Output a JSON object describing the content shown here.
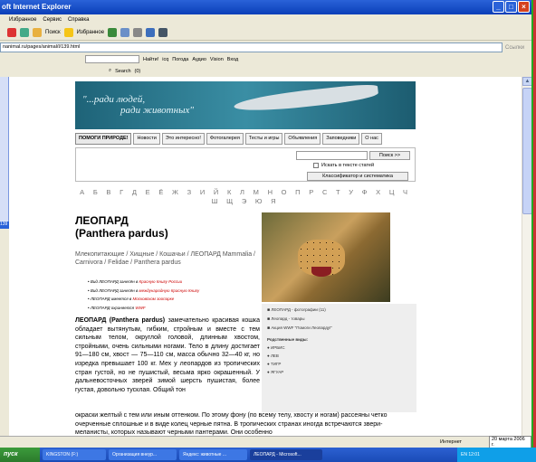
{
  "window": {
    "title": "oft Internet Explorer"
  },
  "menu": [
    "Избранное",
    "Сервис",
    "Справка"
  ],
  "toolbar": {
    "search": "Поиск",
    "favorites": "Избранное"
  },
  "address": {
    "url": "nanimal.ru/pages/animal/l/139.html",
    "links": "Ссылки"
  },
  "toolbar2": {
    "items": [
      "Найти!",
      "icq",
      "Погода",
      "Аудио",
      "Vision",
      "Вход"
    ]
  },
  "toolbar3": {
    "search": "Search",
    "count": "(0)"
  },
  "banner": {
    "line1": "\"...ради людей,",
    "line2": "ради животных\""
  },
  "nav": [
    "ПОМОГИ ПРИРОДЕ!",
    "Новости",
    "Это интересно!",
    "Фотогалерея",
    "Тесты и игры",
    "Объявления",
    "Заповедники",
    "О нас"
  ],
  "search": {
    "button": "Поиск >>",
    "checkbox": "Искать в тексте статей",
    "classifier": "Классификатор и систематика"
  },
  "alphabet": "А Б В Г Д Е Ё Ж З И Й К Л М Н О П Р С Т У Ф Х Ц Ч Ш Щ Э Ю Я",
  "article": {
    "title": "ЛЕОПАРД",
    "latin": "(Panthera pardus)",
    "crumb": "Млекопитающие / Хищные / Кошачьи / ЛЕОПАРД Mammalia / Carnivora / Felidae / Panthera pardus",
    "bullets": [
      {
        "text": "Вид ЛЕОПАРД занесён в ",
        "red": "Красную Книгу России"
      },
      {
        "text": "Вид ЛЕОПАРД занесён в ",
        "red": "международную Красную Книгу"
      },
      {
        "text": "ЛЕОПАРД имеется в ",
        "red": "Московском зоопарке"
      },
      {
        "text": "ЛЕОПАРД охраняется ",
        "red": "WWF"
      }
    ],
    "lead": "ЛЕОПАРД (Panthera pardus)",
    "body": " замечательно красивая кошка обладает вытянутым, гибким, стройным и вместе с тем сильным телом, округлой головой, длинным хвостом, стройными, очень сильными ногами. Тело в длину достигает 91—180 см, хвост — 75—110 см, масса обычно 32—40 кг, но изредка превышает 100 кг. Мех у леопардов из тропических стран густой, но не пушистый, весьма ярко окрашенный. У дальневосточных зверей зимой шерсть пушистая, более густая, довольно тусклая. Общий тон",
    "wide": "окраски желтый с тем или иным оттенком. По этому фону (по всему телу, хвосту и ногам) рассеяны четко очерченные сплошные и в виде колец черные пятна. В тропических странах иногда встречаются звери-меланисты, которых называют черными пантерами. Они особенно"
  },
  "side": {
    "photos": "ЛЕОПАРД - фотографии (11)",
    "goods": "Леопард - товары",
    "action": "Акция WWF \"Помоги Леопарду!\"",
    "related_title": "Родственные виды:",
    "related": [
      "ИРБИС",
      "ЛЕВ",
      "ТИГР",
      "ЯГУАР"
    ]
  },
  "status": {
    "zone": "Интернет",
    "date": "20 марта 2006 г."
  },
  "taskbar": {
    "start": "пуск",
    "tasks": [
      "KINGSTON (F:)",
      "Организация внеур...",
      "Яндекс: животные ...",
      "ЛЕОПАРД - Microsoft..."
    ],
    "tray": "EN  12:01"
  }
}
